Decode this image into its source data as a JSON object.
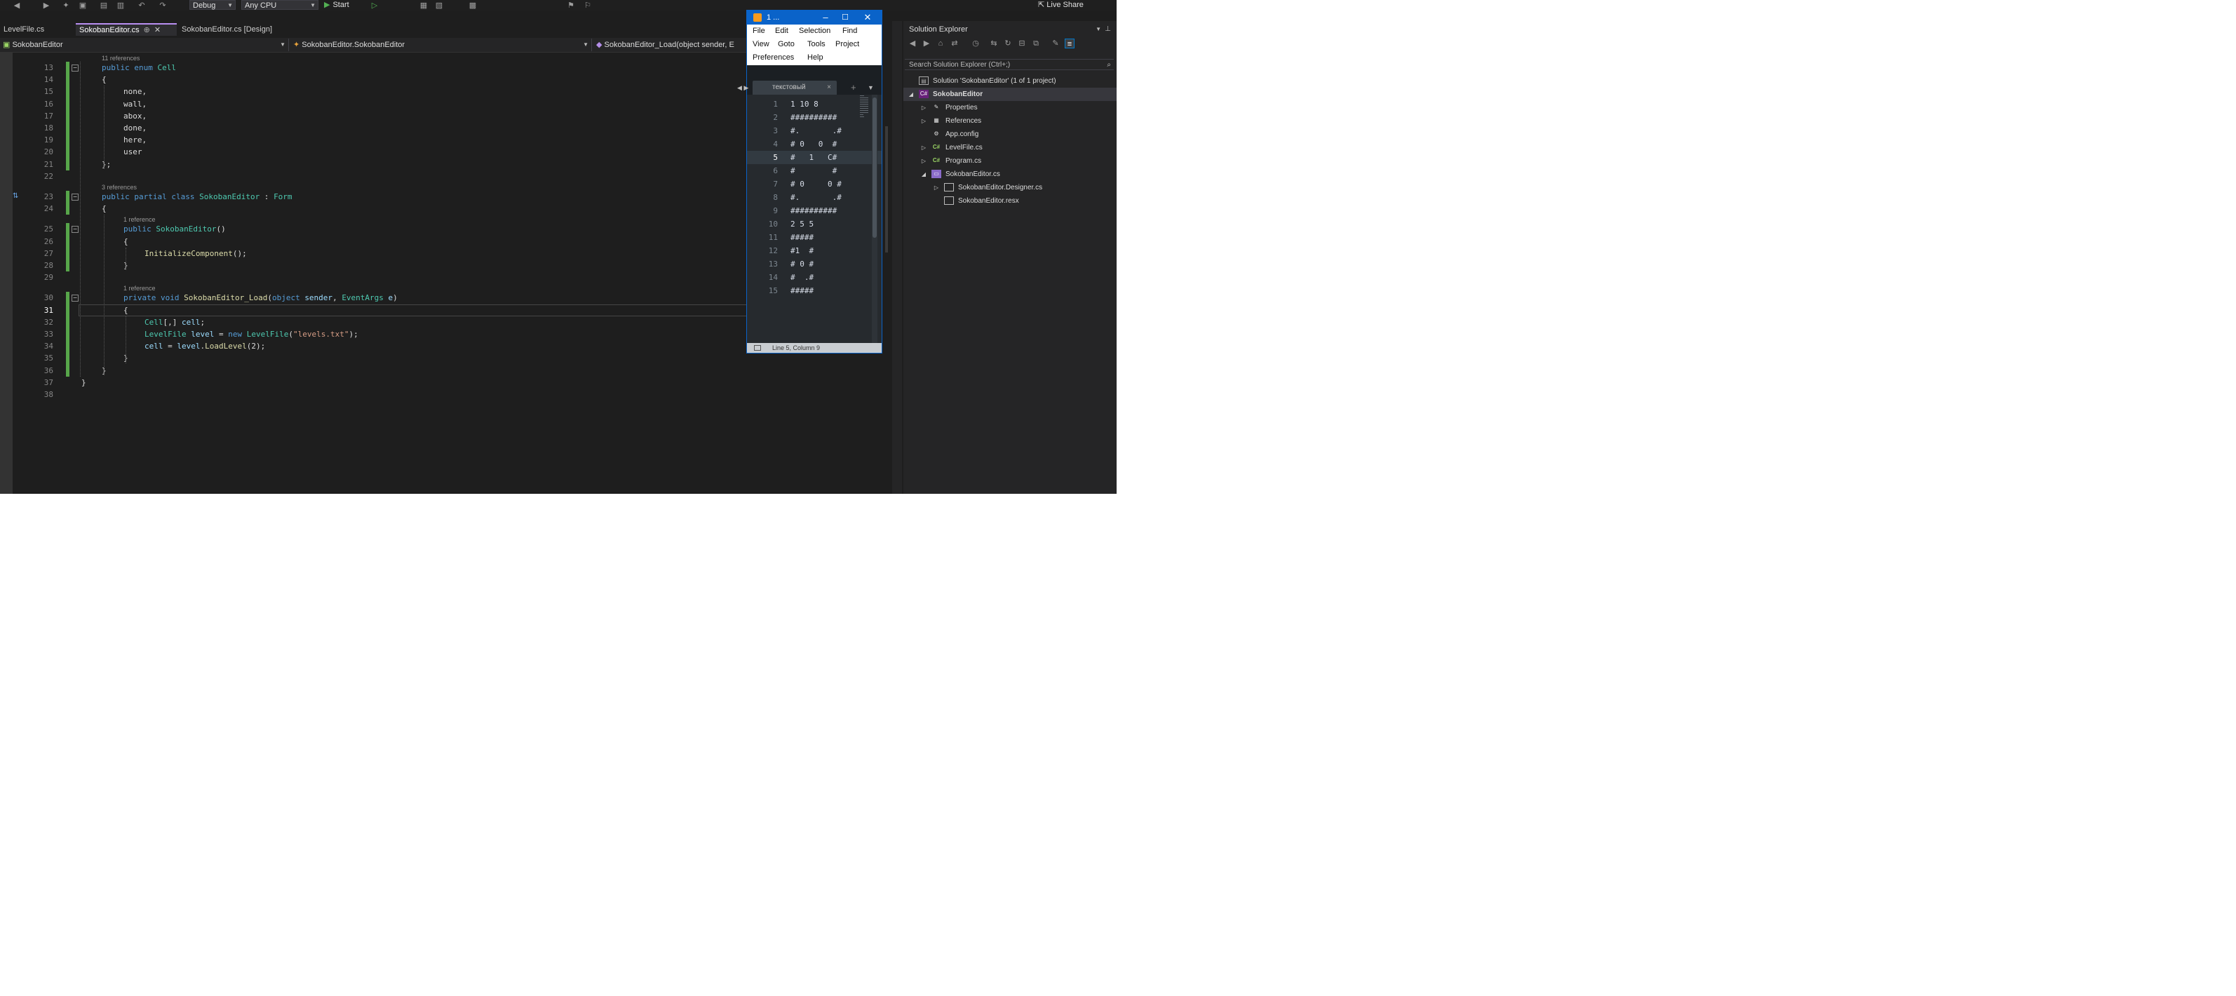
{
  "toolbar": {
    "config": "Debug",
    "platform": "Any CPU",
    "start_label": "Start",
    "live_share": "Live Share"
  },
  "tabs": [
    {
      "label": "LevelFile.cs",
      "active": false
    },
    {
      "label": "SokobanEditor.cs",
      "active": true
    },
    {
      "label": "SokobanEditor.cs [Design]",
      "active": false
    }
  ],
  "navbar": {
    "project": "SokobanEditor",
    "type": "SokobanEditor.SokobanEditor",
    "member": "SokobanEditor_Load(object sender, E"
  },
  "editor": {
    "current_line": 31,
    "lenses": {
      "enum_refs": "11 references",
      "class_refs": "3 references",
      "ctor_refs": "1 reference",
      "load_refs": "1 reference"
    },
    "lines": [
      {
        "n": 13,
        "indent": 1,
        "tokens": [
          [
            "kw",
            "public "
          ],
          [
            "kw",
            "enum "
          ],
          [
            "type",
            "Cell"
          ]
        ]
      },
      {
        "n": 14,
        "indent": 1,
        "tokens": [
          [
            "p",
            "{"
          ]
        ]
      },
      {
        "n": 15,
        "indent": 2,
        "tokens": [
          [
            "p",
            "none,"
          ]
        ]
      },
      {
        "n": 16,
        "indent": 2,
        "tokens": [
          [
            "p",
            "wall,"
          ]
        ]
      },
      {
        "n": 17,
        "indent": 2,
        "tokens": [
          [
            "p",
            "abox,"
          ]
        ]
      },
      {
        "n": 18,
        "indent": 2,
        "tokens": [
          [
            "p",
            "done,"
          ]
        ]
      },
      {
        "n": 19,
        "indent": 2,
        "tokens": [
          [
            "p",
            "here,"
          ]
        ]
      },
      {
        "n": 20,
        "indent": 2,
        "tokens": [
          [
            "p",
            "user"
          ]
        ]
      },
      {
        "n": 21,
        "indent": 1,
        "tokens": [
          [
            "p",
            "};"
          ]
        ]
      },
      {
        "n": 22,
        "indent": 0,
        "tokens": []
      },
      {
        "n": 23,
        "indent": 1,
        "tokens": [
          [
            "kw",
            "public "
          ],
          [
            "kw",
            "partial "
          ],
          [
            "kw",
            "class "
          ],
          [
            "type",
            "SokobanEditor"
          ],
          [
            "p",
            " : "
          ],
          [
            "type",
            "Form"
          ]
        ]
      },
      {
        "n": 24,
        "indent": 1,
        "tokens": [
          [
            "p",
            "{"
          ]
        ]
      },
      {
        "n": 25,
        "indent": 2,
        "tokens": [
          [
            "kw",
            "public "
          ],
          [
            "type",
            "SokobanEditor"
          ],
          [
            "p",
            "()"
          ]
        ]
      },
      {
        "n": 26,
        "indent": 2,
        "tokens": [
          [
            "p",
            "{"
          ]
        ]
      },
      {
        "n": 27,
        "indent": 3,
        "tokens": [
          [
            "method",
            "InitializeComponent"
          ],
          [
            "p",
            "();"
          ]
        ]
      },
      {
        "n": 28,
        "indent": 2,
        "tokens": [
          [
            "p",
            "}"
          ]
        ]
      },
      {
        "n": 29,
        "indent": 0,
        "tokens": []
      },
      {
        "n": 30,
        "indent": 2,
        "tokens": [
          [
            "kw",
            "private "
          ],
          [
            "kw",
            "void "
          ],
          [
            "method",
            "SokobanEditor_Load"
          ],
          [
            "p",
            "("
          ],
          [
            "kw",
            "object "
          ],
          [
            "param",
            "sender"
          ],
          [
            "p",
            ", "
          ],
          [
            "type",
            "EventArgs "
          ],
          [
            "param",
            "e"
          ],
          [
            "p",
            ")"
          ]
        ]
      },
      {
        "n": 31,
        "indent": 2,
        "tokens": [
          [
            "p",
            "{"
          ]
        ]
      },
      {
        "n": 32,
        "indent": 3,
        "tokens": [
          [
            "type",
            "Cell"
          ],
          [
            "p",
            "[,] "
          ],
          [
            "param",
            "cell"
          ],
          [
            "p",
            ";"
          ]
        ]
      },
      {
        "n": 33,
        "indent": 3,
        "tokens": [
          [
            "type",
            "LevelFile "
          ],
          [
            "param",
            "level"
          ],
          [
            "p",
            " = "
          ],
          [
            "kw",
            "new "
          ],
          [
            "type",
            "LevelFile"
          ],
          [
            "p",
            "("
          ],
          [
            "str",
            "\"levels.txt\""
          ],
          [
            "p",
            ");"
          ]
        ]
      },
      {
        "n": 34,
        "indent": 3,
        "tokens": [
          [
            "param",
            "cell"
          ],
          [
            "p",
            " = "
          ],
          [
            "param",
            "level"
          ],
          [
            "p",
            "."
          ],
          [
            "method",
            "LoadLevel"
          ],
          [
            "p",
            "(2);"
          ]
        ]
      },
      {
        "n": 35,
        "indent": 2,
        "tokens": [
          [
            "p",
            "}"
          ]
        ]
      },
      {
        "n": 36,
        "indent": 1,
        "tokens": [
          [
            "p",
            "}"
          ]
        ]
      },
      {
        "n": 37,
        "indent": 0,
        "tokens": [
          [
            "p",
            "}"
          ]
        ]
      },
      {
        "n": 38,
        "indent": 0,
        "tokens": []
      }
    ]
  },
  "popup": {
    "title": "1 ...",
    "menu": [
      "File",
      "Edit",
      "Selection",
      "Find",
      "View",
      "Goto",
      "Tools",
      "Project",
      "Preferences",
      "Help"
    ],
    "tab_label": "текстовый",
    "current_line": 5,
    "lines": [
      "1 10 8",
      "##########",
      "#.       .#",
      "# 0   0  #",
      "#   1   C#",
      "#        #",
      "# 0     0 #",
      "#.       .#",
      "##########",
      "2 5 5",
      "#####",
      "#1  #",
      "# 0 #",
      "#  .#",
      "#####"
    ],
    "status": "Line 5, Column 9"
  },
  "solution_explorer": {
    "title": "Solution Explorer",
    "search_placeholder": "Search Solution Explorer (Ctrl+;)",
    "items": [
      {
        "label": "Solution 'SokobanEditor' (1 of 1 project)",
        "depth": 0,
        "icon": "solution-icon",
        "expander": "",
        "bold": false
      },
      {
        "label": "SokobanEditor",
        "depth": 0,
        "icon": "project-icon",
        "expander": "open",
        "bold": true
      },
      {
        "label": "Properties",
        "depth": 1,
        "icon": "wrench-icon",
        "expander": "closed",
        "bold": false
      },
      {
        "label": "References",
        "depth": 1,
        "icon": "references-icon",
        "expander": "closed",
        "bold": false
      },
      {
        "label": "App.config",
        "depth": 1,
        "icon": "config-icon",
        "expander": "",
        "bold": false
      },
      {
        "label": "LevelFile.cs",
        "depth": 1,
        "icon": "csharp-file-icon",
        "expander": "closed",
        "bold": false
      },
      {
        "label": "Program.cs",
        "depth": 1,
        "icon": "csharp-file-icon",
        "expander": "closed",
        "bold": false
      },
      {
        "label": "SokobanEditor.cs",
        "depth": 1,
        "icon": "form-icon",
        "expander": "open",
        "bold": false
      },
      {
        "label": "SokobanEditor.Designer.cs",
        "depth": 2,
        "icon": "file-icon",
        "expander": "closed",
        "bold": false
      },
      {
        "label": "SokobanEditor.resx",
        "depth": 2,
        "icon": "file-icon",
        "expander": "",
        "bold": false
      }
    ]
  }
}
